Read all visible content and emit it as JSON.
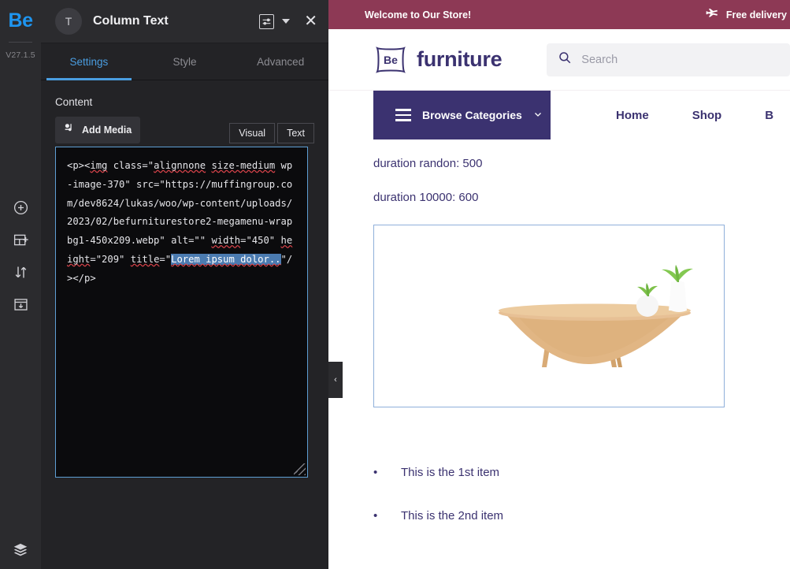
{
  "rail": {
    "logo": "Be",
    "version": "V27.1.5",
    "icons": [
      {
        "name": "add-circle-icon",
        "label": "Add"
      },
      {
        "name": "add-section-icon",
        "label": "Add Section"
      },
      {
        "name": "sort-arrows-icon",
        "label": "Reorder"
      },
      {
        "name": "save-template-icon",
        "label": "Save Template"
      }
    ],
    "bottom_icon": {
      "name": "layers-icon",
      "label": "Layers"
    }
  },
  "panel": {
    "element_icon_letter": "T",
    "element_title": "Column Text",
    "header_buttons": {
      "options_icon": "sliders-icon",
      "dropdown_caret": "chevron-down-icon",
      "close": "close-icon"
    },
    "tabs": [
      {
        "label": "Settings",
        "active": true
      },
      {
        "label": "Style",
        "active": false
      },
      {
        "label": "Advanced",
        "active": false
      }
    ],
    "content_label": "Content",
    "add_media_label": "Add Media",
    "editor_modes": [
      {
        "label": "Visual",
        "active": true
      },
      {
        "label": "Text",
        "active": false
      }
    ],
    "code": {
      "seg1": "<p><",
      "seg2_spell": "img",
      "seg3": " class=\"",
      "seg4_spell": "alignnone",
      "seg5": " ",
      "seg6_spell": "size-medium",
      "seg7": " wp-image-370\" src=\"https://muffingroup.com/dev8624/lukas/woo/wp-content/uploads/2023/02/befurniturestore2-megamenu-wrapbg1-450x209.webp\" alt=\"\" ",
      "seg8_spell": "width",
      "seg9": "=\"450\" ",
      "seg10_spell": "height",
      "seg11": "=\"209\" ",
      "seg12_spell": "title",
      "seg13": "=\"",
      "seg14_selected": "Lorem ipsum dolor..",
      "seg15": "\"/></p>",
      "full_text": "<p><img class=\"alignnone size-medium wp-image-370\" src=\"https://muffingroup.com/dev8624/lukas/woo/wp-content/uploads/2023/02/befurniturestore2-megamenu-wrapbg1-450x209.webp\" alt=\"\" width=\"450\" height=\"209\" title=\"Lorem ipsum dolor..\"/></p>"
    },
    "collapse_handle": "‹"
  },
  "preview": {
    "topbar": {
      "welcome": "Welcome to Our Store!",
      "delivery_icon": "airplane-icon",
      "delivery": "Free delivery"
    },
    "brand": {
      "mark_text": "Be",
      "word": "furniture"
    },
    "search": {
      "icon": "search-icon",
      "placeholder": "Search"
    },
    "nav": {
      "browse_label": "Browse Categories",
      "browse_caret": "chevron-down-icon",
      "burger_icon": "hamburger-icon",
      "links": [
        "Home",
        "Shop",
        "B"
      ]
    },
    "body": {
      "duration_lines": [
        "duration randon: 500",
        "duration 10000: 600"
      ],
      "image_alt": "wooden-table-with-plants",
      "bullets": [
        {
          "marker": "•",
          "text": "This is the 1st item"
        },
        {
          "marker": "•",
          "text": "This is the 2nd item"
        }
      ]
    }
  },
  "colors": {
    "rail_bg": "#2b2b2e",
    "panel_bg": "#232326",
    "accent_blue": "#4a9de0",
    "logo_blue": "#1e95f0",
    "banner_maroon": "#8d3955",
    "brand_purple": "#3b3270",
    "image_border": "#8fb0da",
    "selection_blue": "#4b7bb0"
  }
}
